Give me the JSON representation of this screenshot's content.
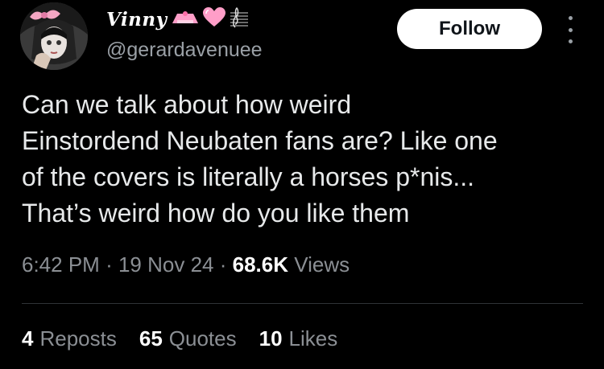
{
  "user": {
    "display_name": "Vinny",
    "handle": "@gerardavenuee",
    "name_emojis": [
      "pink-heart-icon",
      "music-staff-icon"
    ]
  },
  "actions": {
    "follow_label": "Follow"
  },
  "tweet": {
    "text": "Can we talk about how weird\nEinstordend Neubaten fans are? Like one\nof the covers is literally a horses p*nis...\nThat’s weird how do you like them",
    "time": "6:42 PM",
    "sep1": "·",
    "date": "19 Nov 24",
    "sep2": "·",
    "views_count": "68.6K",
    "views_label": "Views"
  },
  "stats": {
    "reposts_count": "4",
    "reposts_label": "Reposts",
    "quotes_count": "65",
    "quotes_label": "Quotes",
    "likes_count": "10",
    "likes_label": "Likes"
  },
  "colors": {
    "background": "#000000",
    "text": "#e7e9ea",
    "secondary": "#8b8f94",
    "follow_bg": "#ffffff",
    "accent_pink": "#ff8fbf"
  }
}
